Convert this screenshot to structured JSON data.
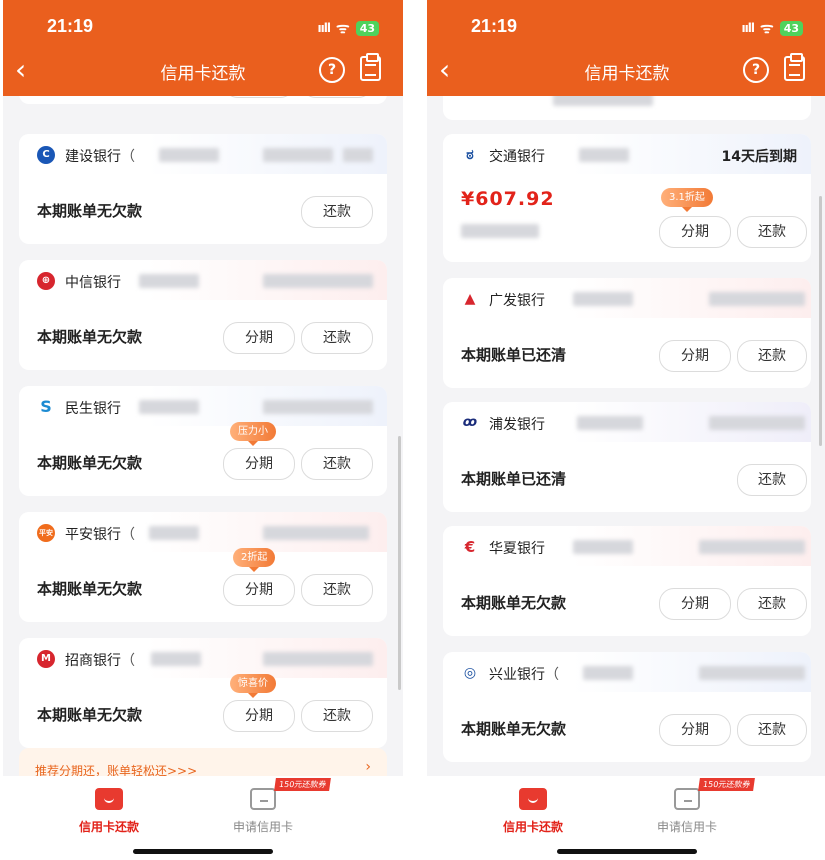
{
  "status_bar": {
    "time": "21:19",
    "signal": "ııll",
    "wifi": "ᯤ",
    "battery": "43"
  },
  "nav": {
    "title": "信用卡还款",
    "back_glyph": "‹",
    "help_glyph": "?"
  },
  "colors": {
    "brand": "#ea5f1e",
    "amount": "#e2231a",
    "accent": "#e8651e"
  },
  "left_screen": {
    "cards": [
      {
        "bank": "建设银行",
        "paren": "（",
        "status": "本期账单无欠款",
        "buttons": [
          "还款"
        ]
      },
      {
        "bank": "中信银行",
        "status": "本期账单无欠款",
        "buttons": [
          "分期",
          "还款"
        ]
      },
      {
        "bank": "民生银行",
        "status": "本期账单无欠款",
        "badge": "压力小",
        "buttons": [
          "分期",
          "还款"
        ]
      },
      {
        "bank": "平安银行",
        "paren": "（",
        "status": "本期账单无欠款",
        "badge": "2折起",
        "buttons": [
          "分期",
          "还款"
        ]
      },
      {
        "bank": "招商银行",
        "paren": "（",
        "status": "本期账单无欠款",
        "badge": "惊喜价",
        "buttons": [
          "分期",
          "还款"
        ]
      }
    ],
    "promo": {
      "text": "推荐分期还，账单轻松还>>>",
      "arrow": "›"
    }
  },
  "right_screen": {
    "cards": [
      {
        "bank": "交通银行",
        "due": "14天后到期",
        "amount": "¥607.92",
        "badge": "3.1折起",
        "buttons": [
          "分期",
          "还款"
        ]
      },
      {
        "bank": "广发银行",
        "status": "本期账单已还清",
        "buttons": [
          "分期",
          "还款"
        ]
      },
      {
        "bank": "浦发银行",
        "status": "本期账单已还清",
        "buttons": [
          "还款"
        ]
      },
      {
        "bank": "华夏银行",
        "status": "本期账单无欠款",
        "buttons": [
          "分期",
          "还款"
        ]
      },
      {
        "bank": "兴业银行",
        "paren": "（",
        "status": "本期账单无欠款",
        "buttons": [
          "分期",
          "还款"
        ]
      }
    ]
  },
  "tabbar": {
    "tab1": "信用卡还款",
    "tab2": "申请信用卡",
    "coupon": "150元还款券"
  }
}
